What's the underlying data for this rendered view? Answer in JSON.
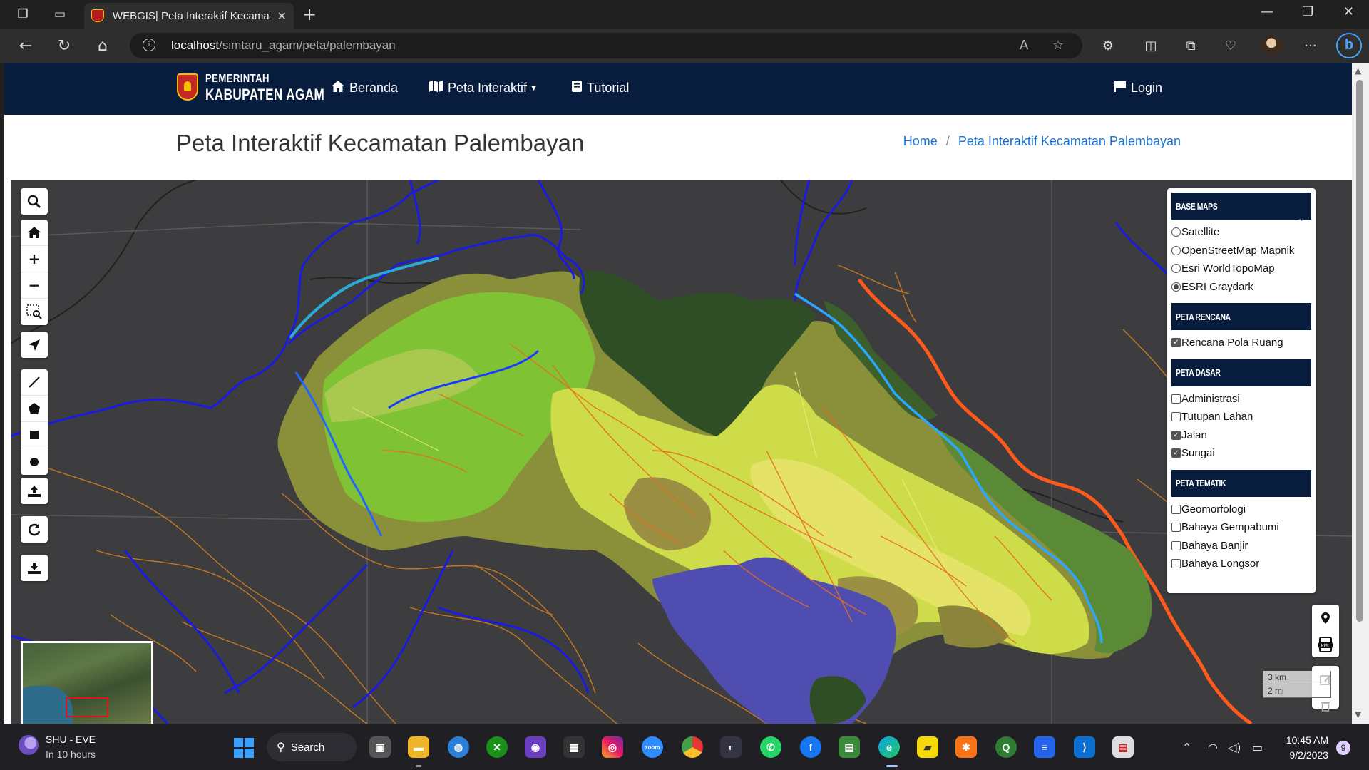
{
  "browser": {
    "tab_title": "WEBGIS| Peta Interaktif Kecamatan Palembayan",
    "url_host": "localhost",
    "url_path": "/simtaru_agam/peta/palembayan"
  },
  "navbar": {
    "logo_line1": "PEMERINTAH",
    "logo_line2": "KABUPATEN AGAM",
    "items": [
      {
        "label": "Beranda",
        "icon": "home-icon"
      },
      {
        "label": "Peta Interaktif",
        "icon": "map-icon"
      },
      {
        "label": "Tutorial",
        "icon": "book-icon"
      }
    ],
    "login_label": "Login"
  },
  "page": {
    "title": "Peta Interaktif Kecamatan Palembayan",
    "breadcrumb": [
      "Home",
      "Peta Interaktif Kecamatan Palembayan"
    ]
  },
  "map_tools": [
    "search-icon",
    "home-icon",
    "zoom-in-icon",
    "zoom-out-icon",
    "zoom-box-icon",
    "locate-icon",
    "draw-line-icon",
    "draw-polygon-icon",
    "draw-rectangle-icon",
    "draw-circle-icon",
    "upload-icon",
    "refresh-icon",
    "download-icon"
  ],
  "layer_panel": {
    "sections": [
      {
        "title": "BASE MAPS",
        "type": "radio",
        "items": [
          {
            "label": "Satellite",
            "checked": false
          },
          {
            "label": "OpenStreetMap Mapnik",
            "checked": false
          },
          {
            "label": "Esri WorldTopoMap",
            "checked": false
          },
          {
            "label": "ESRI Graydark",
            "checked": true
          }
        ]
      },
      {
        "title": "PETA RENCANA",
        "type": "checkbox",
        "items": [
          {
            "label": "Rencana Pola Ruang",
            "checked": true
          }
        ]
      },
      {
        "title": "PETA DASAR",
        "type": "checkbox",
        "items": [
          {
            "label": "Administrasi",
            "checked": false
          },
          {
            "label": "Tutupan Lahan",
            "checked": false
          },
          {
            "label": "Jalan",
            "checked": true
          },
          {
            "label": "Sungai",
            "checked": true
          }
        ]
      },
      {
        "title": "PETA TEMATIK",
        "type": "checkbox",
        "items": [
          {
            "label": "Geomorfologi",
            "checked": false
          },
          {
            "label": "Bahaya Gempabumi",
            "checked": false
          },
          {
            "label": "Bahaya Banjir",
            "checked": false
          },
          {
            "label": "Bahaya Longsor",
            "checked": false
          }
        ]
      }
    ]
  },
  "scale": {
    "km": "3 km",
    "mi": "2 mi"
  },
  "taskbar": {
    "weather_title": "SHU - EVE",
    "weather_sub": "In 10 hours",
    "search_label": "Search",
    "time": "10:45 AM",
    "date": "9/2/2023",
    "notifications": "9"
  },
  "colors": {
    "navbar": "#081d3d",
    "map_bg": "#3d3d3f",
    "link": "#1a73d4"
  }
}
